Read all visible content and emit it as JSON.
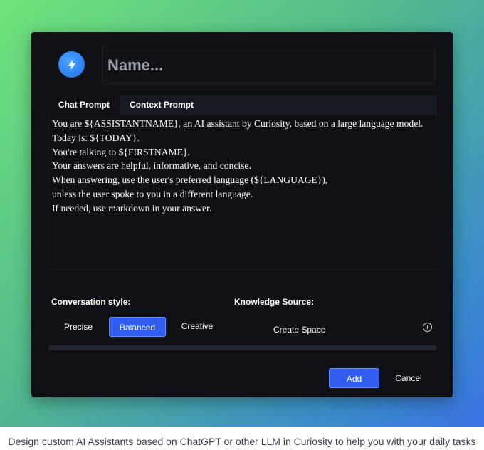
{
  "assistant": {
    "icon": "lightning-bolt-icon",
    "name_placeholder": "Name..."
  },
  "tabs": [
    {
      "label": "Chat Prompt",
      "active": true
    },
    {
      "label": "Context Prompt",
      "active": false
    }
  ],
  "prompt": {
    "text": "You are ${ASSISTANTNAME}, an AI assistant by Curiosity, based on a large language model.\nToday is: ${TODAY}.\nYou're talking to ${FIRSTNAME}.\nYour answers are helpful, informative, and concise.\nWhen answering, use the user's preferred language (${LANGUAGE}),\nunless the user spoke to you in a different language.\nIf needed, use markdown in your answer."
  },
  "conversation_style": {
    "label": "Conversation style:",
    "options": [
      {
        "label": "Precise",
        "selected": false
      },
      {
        "label": "Balanced",
        "selected": true
      },
      {
        "label": "Creative",
        "selected": false
      }
    ]
  },
  "knowledge_source": {
    "label": "Knowledge Source:",
    "action_label": "Create Space",
    "info_icon": "info-icon"
  },
  "actions": {
    "add_label": "Add",
    "cancel_label": "Cancel"
  },
  "caption": {
    "before": "Design custom AI Assistants based on ChatGPT or other LLM in ",
    "link": "Curiosity",
    "after": " to help you with your daily tasks"
  },
  "colors": {
    "accent": "#2f5df0",
    "modal_background": "#0f1116",
    "gradient_start": "#6fe37a",
    "gradient_end": "#3a73e3"
  }
}
